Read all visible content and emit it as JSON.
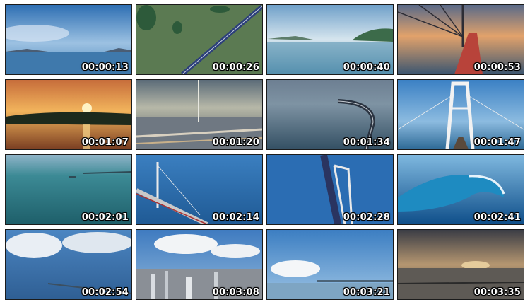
{
  "thumbnails": [
    {
      "timestamp": "00:00:13"
    },
    {
      "timestamp": "00:00:26"
    },
    {
      "timestamp": "00:00:40"
    },
    {
      "timestamp": "00:00:53"
    },
    {
      "timestamp": "00:01:07"
    },
    {
      "timestamp": "00:01:20"
    },
    {
      "timestamp": "00:01:34"
    },
    {
      "timestamp": "00:01:47"
    },
    {
      "timestamp": "00:02:01"
    },
    {
      "timestamp": "00:02:14"
    },
    {
      "timestamp": "00:02:28"
    },
    {
      "timestamp": "00:02:41"
    },
    {
      "timestamp": "00:02:54"
    },
    {
      "timestamp": "00:03:08"
    },
    {
      "timestamp": "00:03:21"
    },
    {
      "timestamp": "00:03:35"
    }
  ]
}
